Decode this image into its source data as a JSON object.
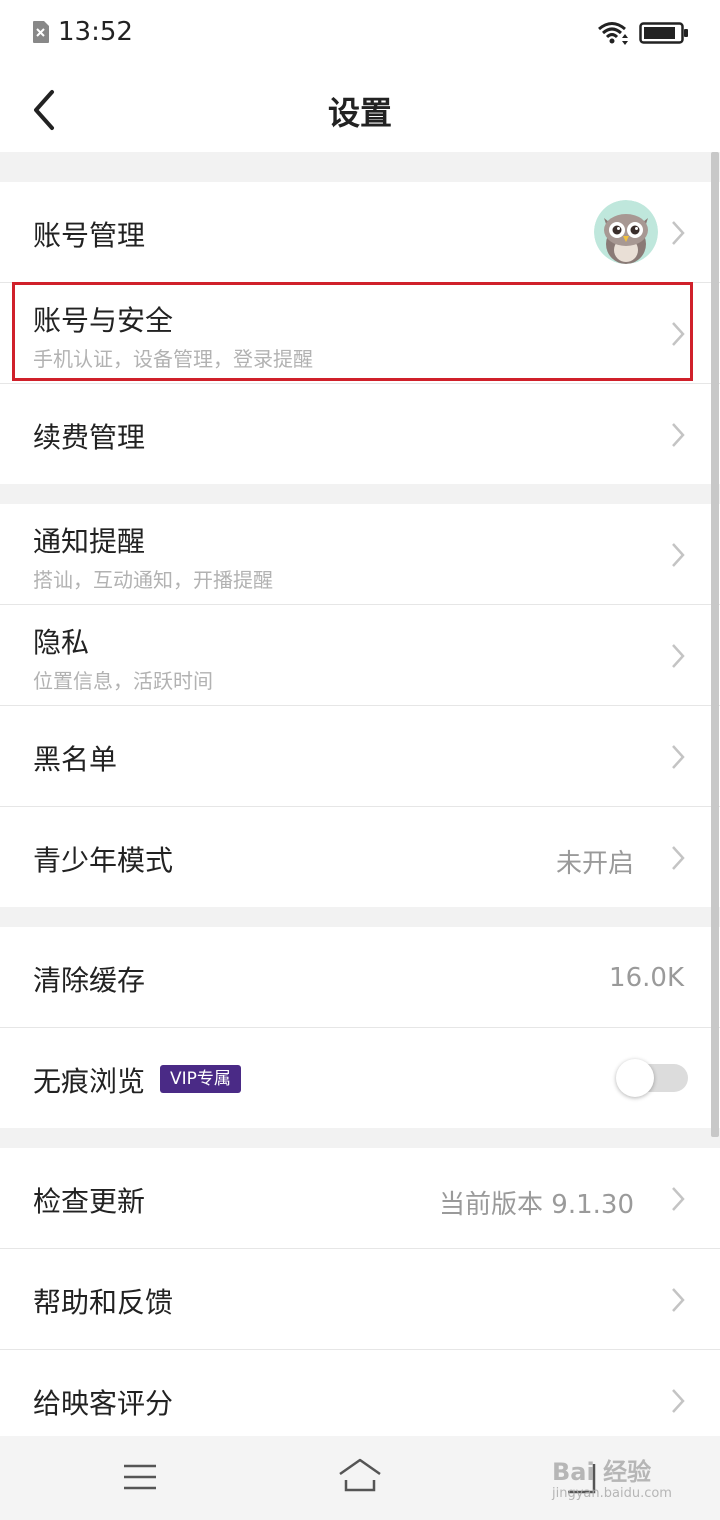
{
  "status_bar": {
    "time": "13:52",
    "icons": [
      "sim-off-icon",
      "wifi-icon",
      "battery-icon"
    ]
  },
  "header": {
    "title": "设置",
    "back_icon": "chevron-left-icon"
  },
  "groups": [
    {
      "items": [
        {
          "title": "账号管理",
          "has_avatar": true,
          "avatar_icon": "owl-avatar"
        },
        {
          "title": "账号与安全",
          "subtitle": "手机认证，设备管理，登录提醒",
          "highlighted": true
        },
        {
          "title": "续费管理"
        }
      ]
    },
    {
      "items": [
        {
          "title": "通知提醒",
          "subtitle": "搭讪，互动通知，开播提醒"
        },
        {
          "title": "隐私",
          "subtitle": "位置信息，活跃时间"
        },
        {
          "title": "黑名单"
        },
        {
          "title": "青少年模式",
          "value": "未开启"
        }
      ]
    },
    {
      "items": [
        {
          "title": "清除缓存",
          "value": "16.0K"
        },
        {
          "title": "无痕浏览",
          "badge": "VIP专属",
          "toggle_on": false
        }
      ]
    },
    {
      "items": [
        {
          "title": "检查更新",
          "value": "当前版本 9.1.30"
        },
        {
          "title": "帮助和反馈"
        },
        {
          "title": "给映客评分"
        }
      ]
    }
  ],
  "bottom_nav": {
    "icons": [
      "menu-icon",
      "home-icon",
      "back-icon"
    ]
  },
  "watermark": {
    "text": "Bai 经验",
    "sub": "jingyan.baidu.com"
  },
  "colors": {
    "highlight": "#d0202a",
    "vip_badge": "#4a2a86",
    "background": "#f2f2f2"
  }
}
